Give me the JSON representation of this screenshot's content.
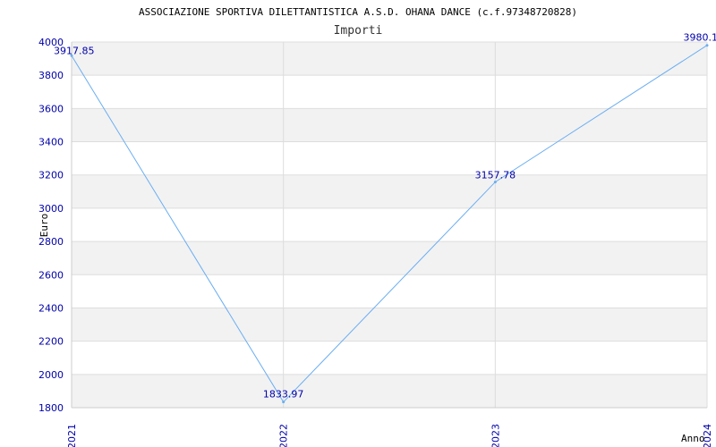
{
  "chart_data": {
    "type": "line",
    "title": "ASSOCIAZIONE SPORTIVA DILETTANTISTICA A.S.D. OHANA DANCE (c.f.97348720828)",
    "subtitle": "Importi",
    "xlabel": "Anno",
    "ylabel": "Euro",
    "categories": [
      "2021",
      "2022",
      "2023",
      "2024"
    ],
    "series": [
      {
        "values": [
          3917.85,
          1833.97,
          3157.78,
          3980.1
        ],
        "labels": [
          "3917.85",
          "1833.97",
          "3157.78",
          "3980.1"
        ]
      }
    ],
    "ylim": [
      1800,
      4000
    ],
    "yticks": [
      "1800",
      "2000",
      "2200",
      "2400",
      "2600",
      "2800",
      "3000",
      "3200",
      "3400",
      "3600",
      "3800",
      "4000"
    ],
    "grid": true,
    "colors": {
      "line": "#6aaef2",
      "tick_text": "#0000aa",
      "band": "#f2f2f2",
      "grid": "#dddddd",
      "axis": "#cccccc"
    }
  }
}
